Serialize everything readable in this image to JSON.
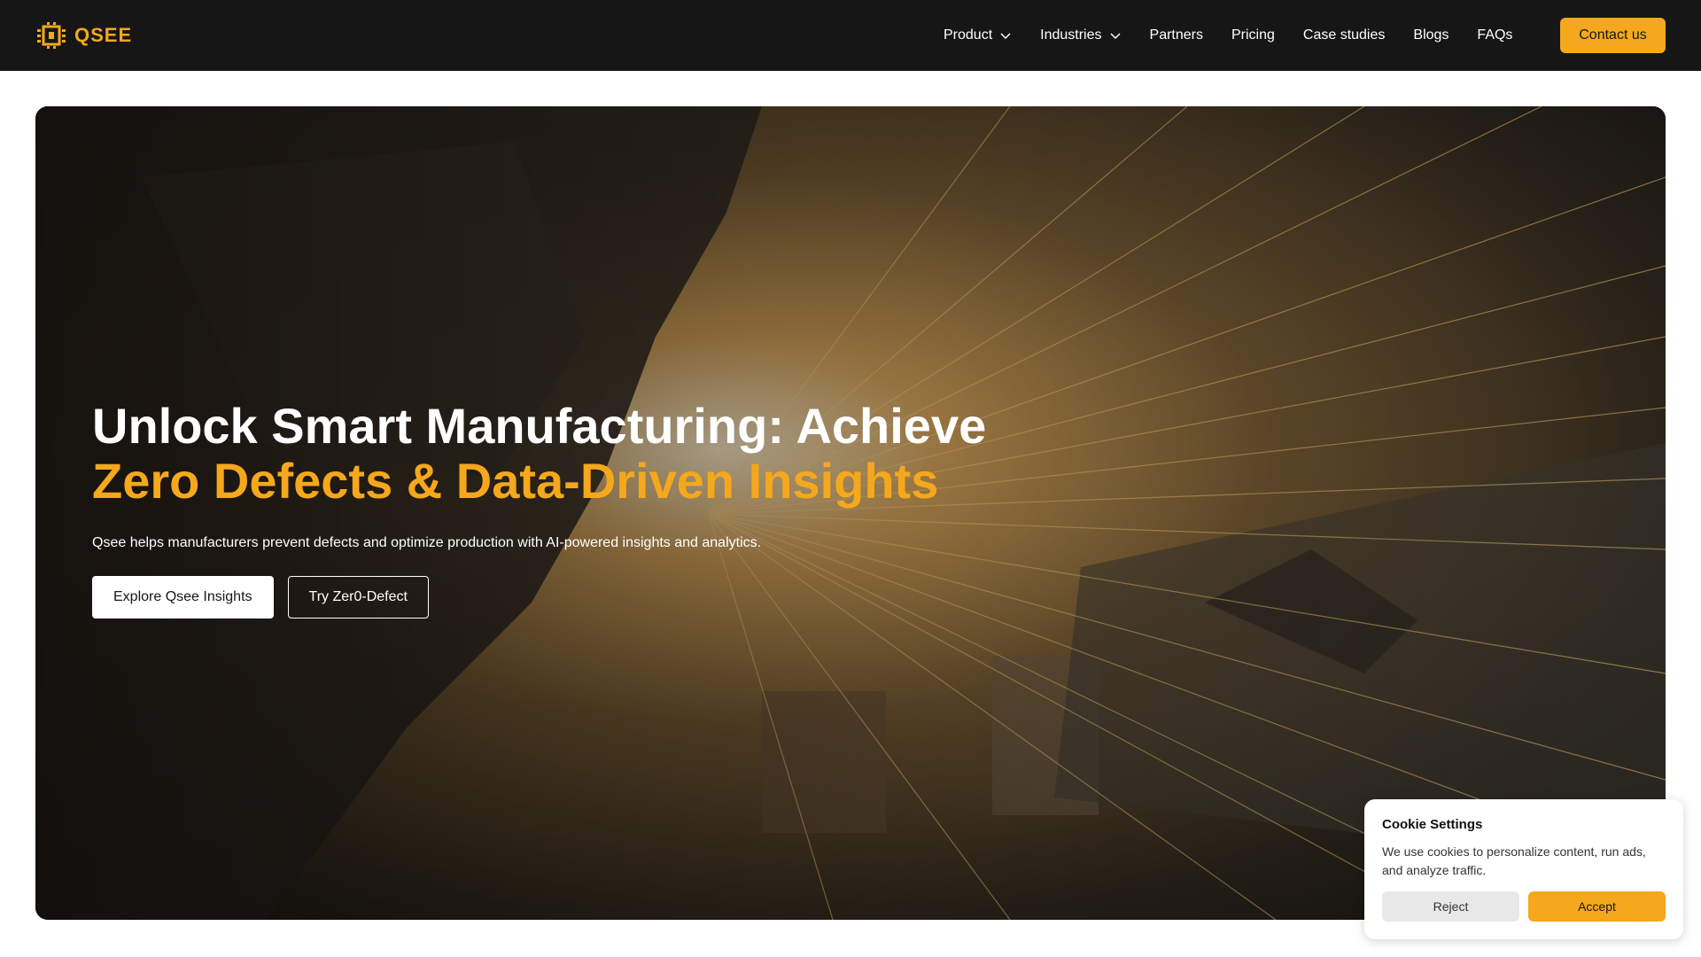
{
  "brand": {
    "logo_text": "QSEE",
    "accent_color": "#f5a81c",
    "nav_bg": "#161616"
  },
  "nav": {
    "items": [
      {
        "label": "Product",
        "dropdown": true
      },
      {
        "label": "Industries",
        "dropdown": true
      },
      {
        "label": "Partners",
        "dropdown": false
      },
      {
        "label": "Pricing",
        "dropdown": false
      },
      {
        "label": "Case studies",
        "dropdown": false
      },
      {
        "label": "Blogs",
        "dropdown": false
      },
      {
        "label": "FAQs",
        "dropdown": false
      }
    ],
    "contact_label": "Contact us"
  },
  "hero": {
    "title_line1": "Unlock Smart Manufacturing: Achieve",
    "title_line2": "Zero Defects & Data-Driven Insights",
    "subtitle": "Qsee helps manufacturers prevent defects and optimize production with AI-powered insights and analytics.",
    "primary_button": "Explore Qsee Insights",
    "secondary_button": "Try Zer0-Defect"
  },
  "cookie": {
    "title": "Cookie Settings",
    "text": "We use cookies to personalize content, run ads, and analyze traffic.",
    "reject_label": "Reject",
    "accept_label": "Accept"
  },
  "icons": {
    "logo": "chip-logo-icon",
    "dropdown": "chevron-down-icon"
  }
}
